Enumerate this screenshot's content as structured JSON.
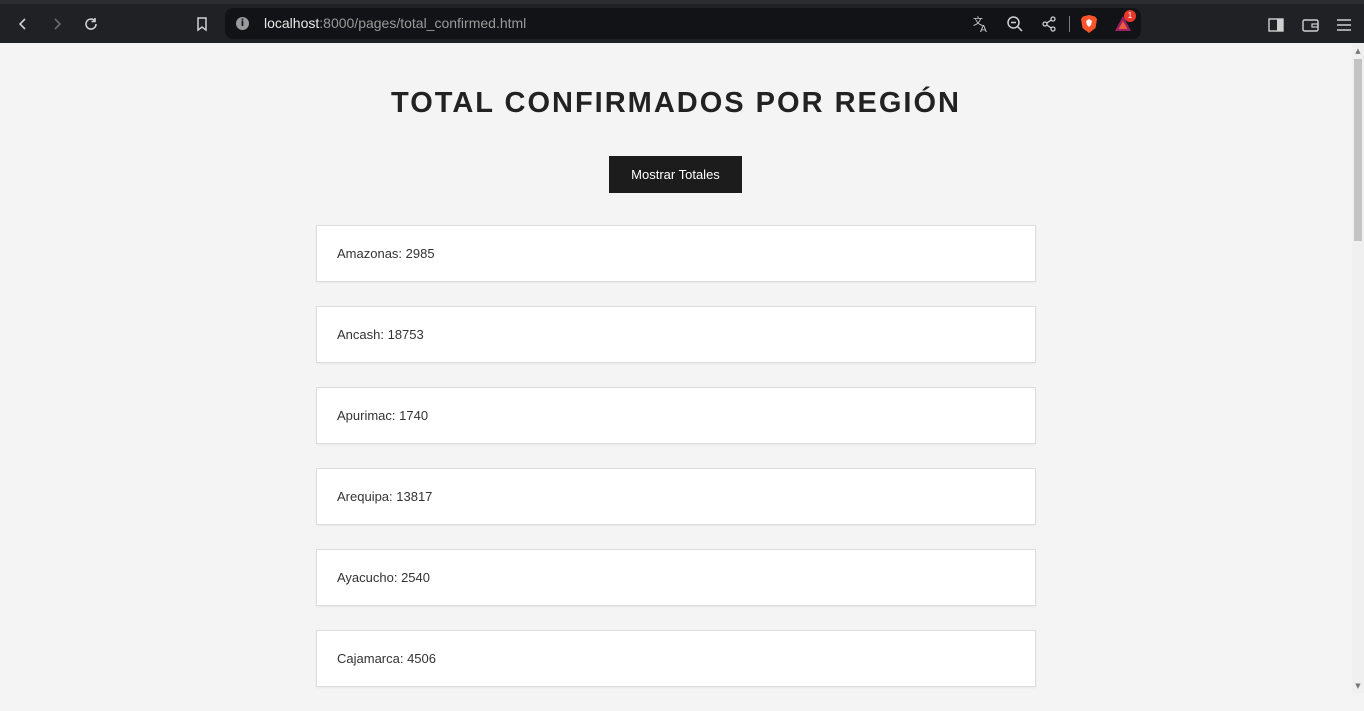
{
  "browser": {
    "url_host": "localhost",
    "url_rest": ":8000/pages/total_confirmed.html",
    "notification_count": "1"
  },
  "page": {
    "title": "TOTAL CONFIRMADOS POR REGIÓN",
    "show_button_label": "Mostrar Totales"
  },
  "regions": [
    "Amazonas: 2985",
    "Ancash: 18753",
    "Apurimac: 1740",
    "Arequipa: 13817",
    "Ayacucho: 2540",
    "Cajamarca: 4506"
  ]
}
